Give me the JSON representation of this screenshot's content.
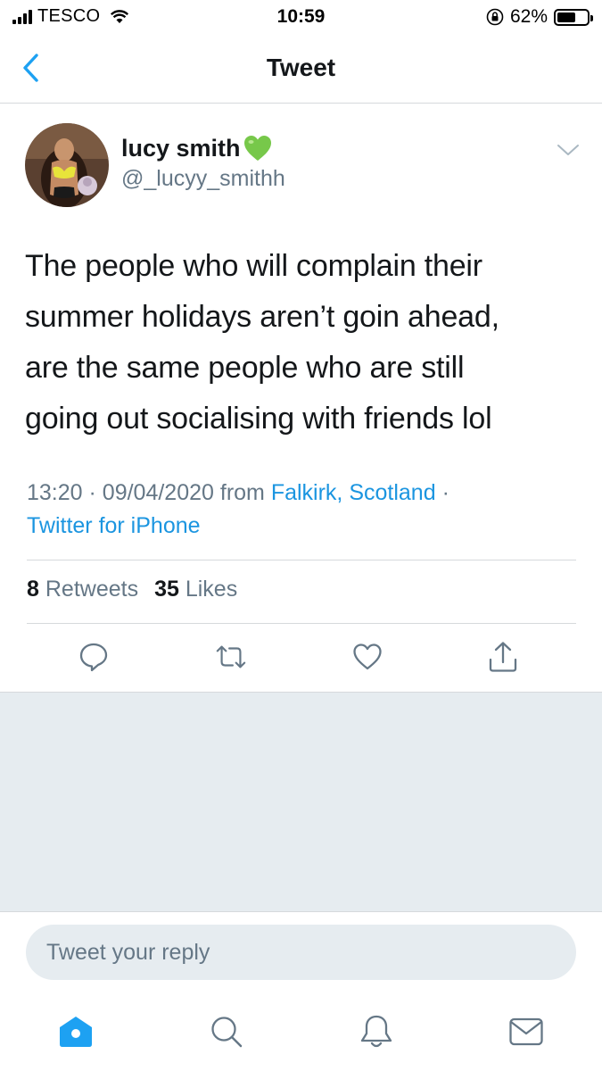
{
  "status_bar": {
    "carrier": "TESCO",
    "time": "10:59",
    "battery_percent": "62%",
    "battery_level": 0.62
  },
  "nav": {
    "title": "Tweet",
    "back_icon": "chevron-left-icon"
  },
  "tweet": {
    "user_name": "lucy smith",
    "user_emoji": "green-heart-icon",
    "user_handle": "@_lucyy_smithh",
    "text_lines": [
      "The people who will complain their",
      "summer holidays aren’t goin ahead,",
      "are the same people who are still",
      "going out socialising with friends lol"
    ],
    "time": "13:20",
    "date": "09/04/2020",
    "from_label": "from",
    "location": "Falkirk, Scotland",
    "client": "Twitter for iPhone",
    "separator": "·"
  },
  "stats": {
    "retweets_count": "8",
    "retweets_label": "Retweets",
    "likes_count": "35",
    "likes_label": "Likes"
  },
  "actions": [
    "reply-icon",
    "retweet-icon",
    "like-icon",
    "share-icon"
  ],
  "reply": {
    "placeholder": "Tweet your reply"
  },
  "tab_bar": [
    "home-icon",
    "search-icon",
    "notifications-icon",
    "messages-icon"
  ],
  "colors": {
    "accent": "#1da1f2",
    "link": "#1b95e0",
    "secondary_text": "#657786",
    "background_gray": "#e6ecf0",
    "divider": "#d6d9dc"
  }
}
